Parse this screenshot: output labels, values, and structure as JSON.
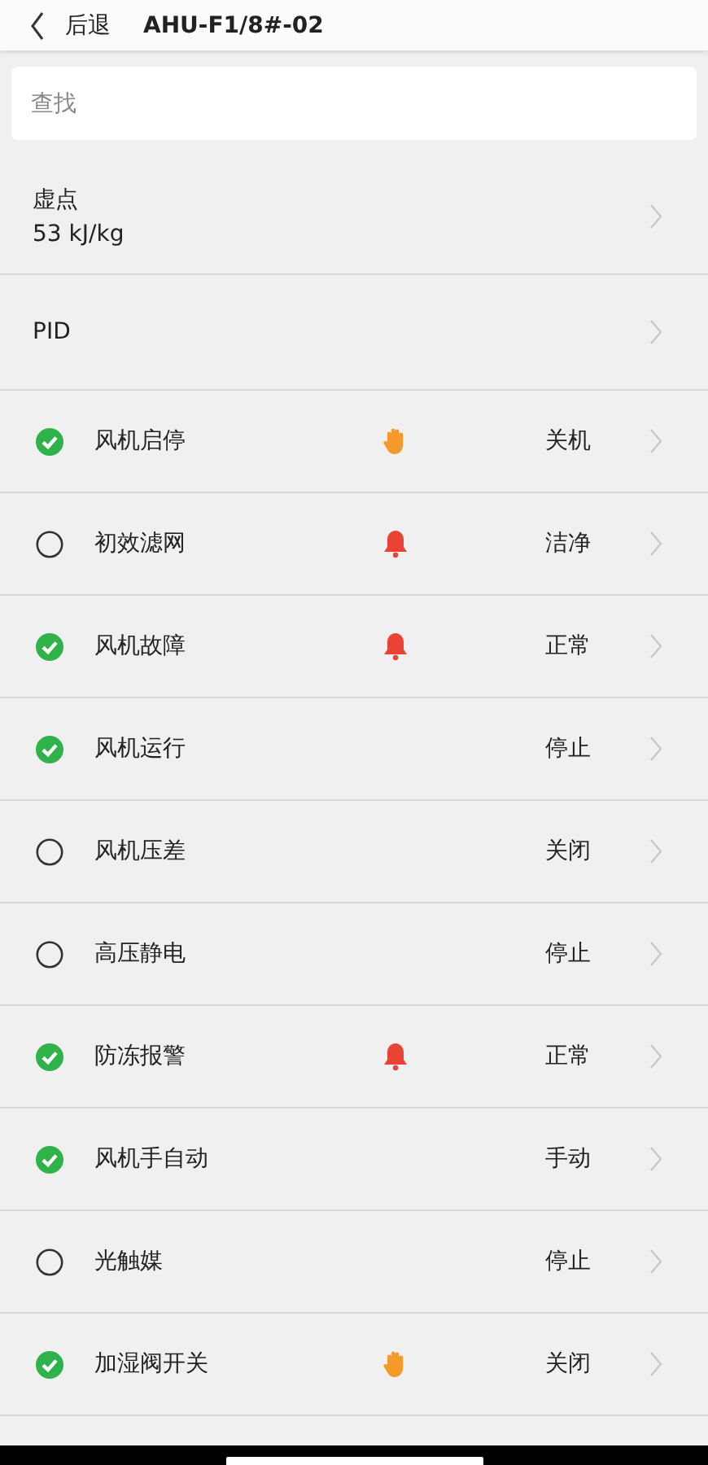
{
  "header": {
    "back_label": "后退",
    "title": "AHU-F1/8#-02"
  },
  "search": {
    "placeholder": "查找"
  },
  "top_items": [
    {
      "label": "虚点",
      "value": "53 kJ/kg"
    },
    {
      "label": "PID"
    }
  ],
  "points": [
    {
      "checked": true,
      "name": "风机启停",
      "kind": "hand",
      "value": "关机"
    },
    {
      "checked": false,
      "name": "初效滤网",
      "kind": "bell",
      "value": "洁净"
    },
    {
      "checked": true,
      "name": "风机故障",
      "kind": "bell",
      "value": "正常"
    },
    {
      "checked": true,
      "name": "风机运行",
      "kind": "plain",
      "value": "停止"
    },
    {
      "checked": false,
      "name": "风机压差",
      "kind": "plain",
      "value": "关闭"
    },
    {
      "checked": false,
      "name": "高压静电",
      "kind": "plain",
      "value": "停止"
    },
    {
      "checked": true,
      "name": "防冻报警",
      "kind": "bell",
      "value": "正常"
    },
    {
      "checked": true,
      "name": "风机手自动",
      "kind": "plain",
      "value": "手动"
    },
    {
      "checked": false,
      "name": "光触媒",
      "kind": "plain",
      "value": "停止"
    },
    {
      "checked": true,
      "name": "加湿阀开关",
      "kind": "hand",
      "value": "关闭"
    }
  ]
}
